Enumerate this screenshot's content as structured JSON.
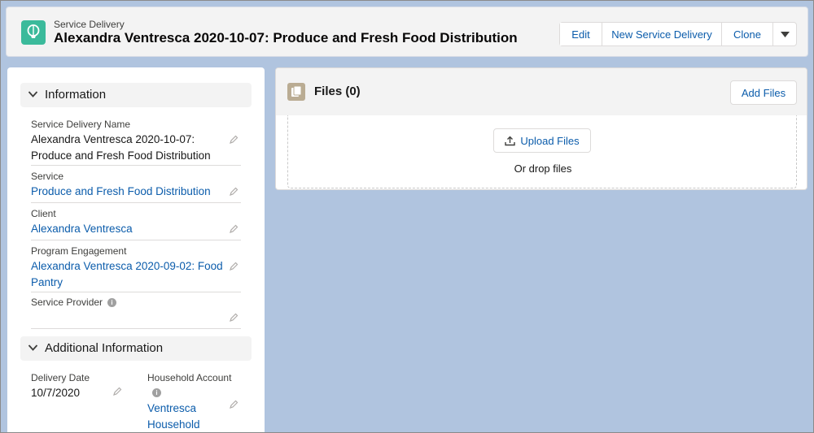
{
  "header": {
    "object_type": "Service Delivery",
    "record_title": "Alexandra Ventresca 2020-10-07: Produce and Fresh Food Distribution",
    "buttons": {
      "edit": "Edit",
      "new_service_delivery": "New Service Delivery",
      "clone": "Clone"
    }
  },
  "information": {
    "section_title": "Information",
    "fields": {
      "service_delivery_name": {
        "label": "Service Delivery Name",
        "value_line1": "Alexandra Ventresca 2020-10-07:",
        "value_line2": "Produce and Fresh Food Distribution"
      },
      "service": {
        "label": "Service",
        "value": "Produce and Fresh Food Distribution"
      },
      "client": {
        "label": "Client",
        "value": "Alexandra Ventresca"
      },
      "program_engagement": {
        "label": "Program Engagement",
        "value_line1": "Alexandra Ventresca 2020-09-02: Food",
        "value_line2": "Pantry"
      },
      "service_provider": {
        "label": "Service Provider",
        "value": ""
      }
    }
  },
  "additional_information": {
    "section_title": "Additional Information",
    "fields": {
      "delivery_date": {
        "label": "Delivery Date",
        "value": "10/7/2020"
      },
      "household_account": {
        "label": "Household Account",
        "value_line1": "Ventresca",
        "value_line2": "Household"
      }
    }
  },
  "files": {
    "title": "Files (0)",
    "add_files": "Add Files",
    "upload_files": "Upload Files",
    "drop_text": "Or drop files"
  },
  "icons": {
    "object": "hot-air-balloon-icon",
    "files": "files-icon",
    "upload": "upload-icon",
    "pencil": "pencil-icon",
    "info": "info-icon",
    "chevron": "chevron-down-icon"
  },
  "colors": {
    "brand_link": "#0b5cab",
    "object_icon": "#3bba9b",
    "files_icon": "#baac93",
    "page_background": "#b0c4df"
  }
}
